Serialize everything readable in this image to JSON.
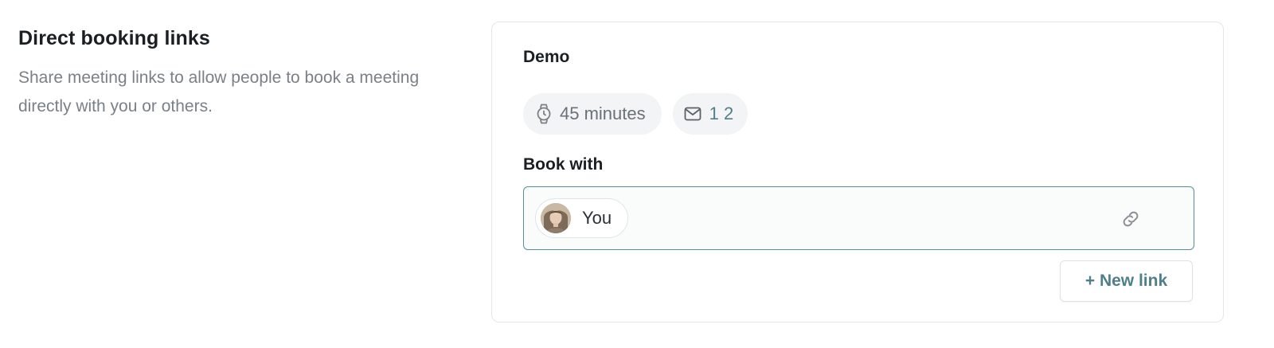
{
  "section": {
    "title": "Direct booking links",
    "description": "Share meeting links to allow people to book a meeting directly with you or others."
  },
  "booking_link": {
    "name": "Demo",
    "duration_label": "45 minutes",
    "duration_icon": "stopwatch-icon",
    "count_icon": "mail-icon",
    "count_label": "1 2",
    "book_with_label": "Book with",
    "members": [
      {
        "name": "You",
        "avatar_icon": "avatar"
      }
    ],
    "copy_icon": "link-icon",
    "new_link_label": "+ New link"
  },
  "colors": {
    "accent": "#4f7f8a",
    "border_focus": "#5b8d96",
    "muted_text": "#7a8087",
    "chip_bg": "#f3f4f5"
  }
}
